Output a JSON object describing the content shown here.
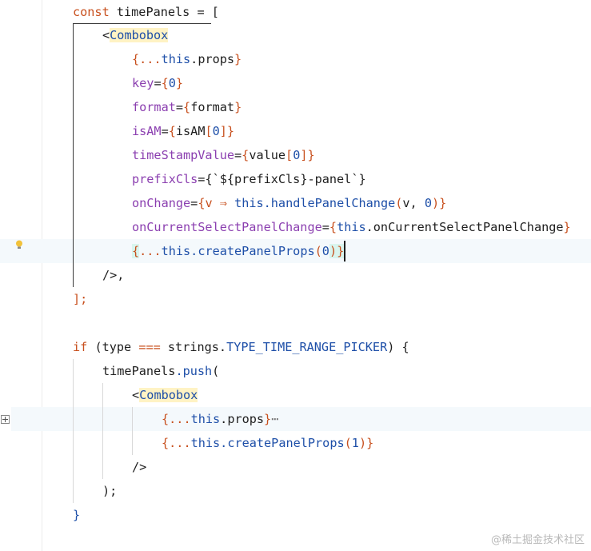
{
  "colors": {
    "keyword": "#c8501e",
    "attribute": "#8b3fb0",
    "this": "#1e4fa8",
    "tag_highlight": "#fff3c4",
    "current_line": "#f4f9fc",
    "background": "#ffffff"
  },
  "code_lines": [
    {
      "t1": "const ",
      "t2": "timePanels",
      "t3": " = ["
    },
    {
      "t1": "<",
      "t2": "Combobox"
    },
    {
      "t1": "{",
      "t2": "...",
      "t3": "this",
      "t4": ".props",
      "t5": "}"
    },
    {
      "t1": "key",
      "t2": "=",
      "t3": "{",
      "t4": "0",
      "t5": "}"
    },
    {
      "t1": "format",
      "t2": "=",
      "t3": "{",
      "t4": "format",
      "t5": "}"
    },
    {
      "t1": "isAM",
      "t2": "=",
      "t3": "{",
      "t4": "isAM",
      "t5": "[",
      "t6": "0",
      "t7": "]}"
    },
    {
      "t1": "timeStampValue",
      "t2": "=",
      "t3": "{",
      "t4": "value",
      "t5": "[",
      "t6": "0",
      "t7": "]}"
    },
    {
      "t1": "prefixCls",
      "t2": "=",
      "t3": "{`${prefixCls}-panel`}"
    },
    {
      "t1": "onChange",
      "t2": "=",
      "t3": "{",
      "t4": "v",
      "t5": " ⇒ ",
      "t6": "this",
      "t7": ".handlePanelChange",
      "t8": "(",
      "t9": "v",
      "t10": ", ",
      "t11": "0",
      "t12": ")}"
    },
    {
      "t1": "onCurrentSelectPanelChange",
      "t2": "=",
      "t3": "{",
      "t4": "this",
      "t5": ".onCurrentSelectPanelChange",
      "t6": "}"
    },
    {
      "t1": "{",
      "t2": "...",
      "t3": "this",
      "t4": ".createPanelProps",
      "t5": "(",
      "t6": "0",
      "t7": ")}"
    },
    {
      "t1": "/>,"
    },
    {
      "t1": "];"
    },
    {
      "t1": ""
    },
    {
      "t1": "if",
      "t2": " (",
      "t3": "type",
      "t4": " ",
      "t5": "===",
      "t6": " strings.",
      "t7": "TYPE_TIME_RANGE_PICKER",
      "t8": ") {"
    },
    {
      "t1": "timePanels",
      "t2": ".push",
      "t3": "("
    },
    {
      "t1": "<",
      "t2": "Combobox"
    },
    {
      "t1": "{",
      "t2": "...",
      "t3": "this",
      "t4": ".props",
      "t5": "}",
      "t6": "⋯"
    },
    {
      "t1": "{",
      "t2": "...",
      "t3": "this",
      "t4": ".createPanelProps",
      "t5": "(",
      "t6": "1",
      "t7": ")}"
    },
    {
      "t1": "/>"
    },
    {
      "t1": ");"
    },
    {
      "t1": "}"
    }
  ],
  "watermark": "@稀土掘金技术社区",
  "gutter": {
    "bulb_icon": "lightbulb-icon",
    "fold_icon": "fold-expand-icon"
  }
}
